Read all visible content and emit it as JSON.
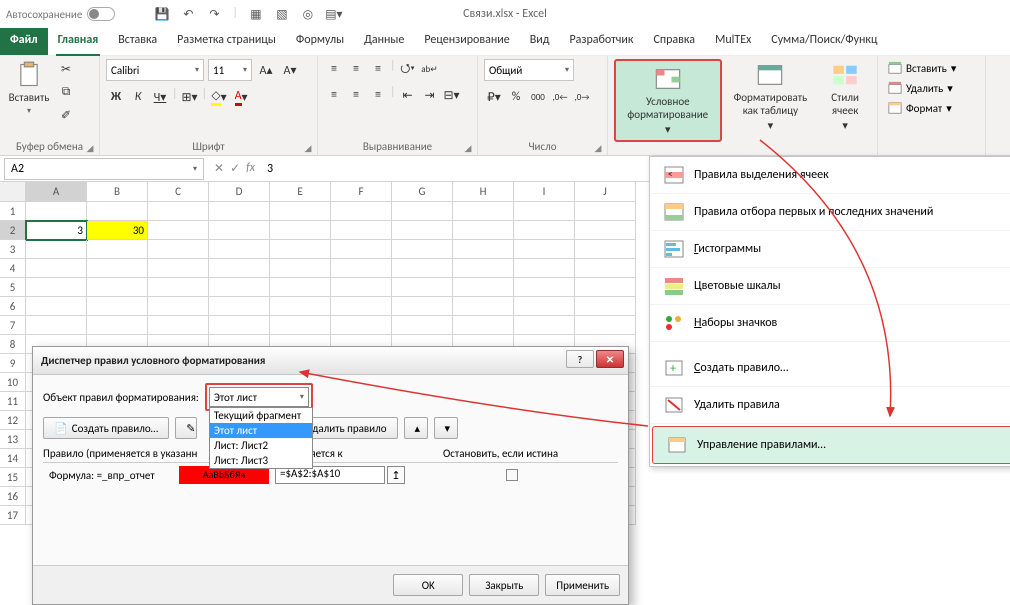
{
  "titlebar": {
    "autosave_label": "Автосохранение",
    "filename": "Связи.xlsx",
    "app": "Excel"
  },
  "tabs": {
    "file": "Файл",
    "home": "Главная",
    "insert": "Вставка",
    "page_layout": "Разметка страницы",
    "formulas": "Формулы",
    "data": "Данные",
    "review": "Рецензирование",
    "view": "Вид",
    "developer": "Разработчик",
    "help": "Справка",
    "multex": "MulTEx",
    "sum": "Сумма/Поиск/Функц"
  },
  "ribbon": {
    "clipboard": {
      "label": "Буфер обмена",
      "paste": "Вставить"
    },
    "font": {
      "label": "Шрифт",
      "name": "Calibri",
      "size": "11"
    },
    "align": {
      "label": "Выравнивание"
    },
    "number": {
      "label": "Число",
      "format": "Общий"
    },
    "styles": {
      "cond_fmt": "Условное форматирование",
      "format_table": "Форматировать как таблицу",
      "cell_styles": "Стили ячеек"
    },
    "cells": {
      "insert": "Вставить",
      "delete": "Удалить",
      "format": "Формат"
    }
  },
  "formula_bar": {
    "name_box": "A2",
    "formula": "3"
  },
  "grid": {
    "cols": [
      "A",
      "B",
      "C",
      "D",
      "E",
      "F",
      "G",
      "H",
      "I",
      "J"
    ],
    "rows": [
      "1",
      "2",
      "3",
      "4",
      "5",
      "6",
      "7",
      "8",
      "9",
      "10",
      "11",
      "12",
      "13",
      "14",
      "15",
      "16",
      "17"
    ],
    "data": {
      "A2": "3",
      "B2": "30"
    }
  },
  "cf_menu": {
    "highlight": "Правила выделения ячеек",
    "top_bottom": "Правила отбора первых и последних значений",
    "data_bars": "Гистограммы",
    "color_scales": "Цветовые шкалы",
    "icon_sets": "Наборы значков",
    "new_rule": "Создать правило…",
    "clear": "Удалить правила",
    "manage": "Управление правилами…"
  },
  "dialog": {
    "title": "Диспетчер правил условного форматирования",
    "object_label": "Объект правил форматирования:",
    "scope_selected": "Этот лист",
    "scope_options": [
      "Текущий фрагмент",
      "Этот лист",
      "Лист: Лист2",
      "Лист: Лист3"
    ],
    "new_btn": "Создать правило…",
    "edit_btn": "Изменить правило…",
    "delete_btn": "Удалить правило",
    "col_rule": "Правило (применяется в указанн",
    "col_applies": "Применяется к",
    "col_stop": "Остановить, если истина",
    "rule_formula_label": "Формула:",
    "rule_formula": "=_впр_отчет",
    "rule_preview": "АаBbБбЯя",
    "applies_to": "=$A$2:$A$10",
    "btn_ok": "OK",
    "btn_close": "Закрыть",
    "btn_apply": "Применить"
  }
}
